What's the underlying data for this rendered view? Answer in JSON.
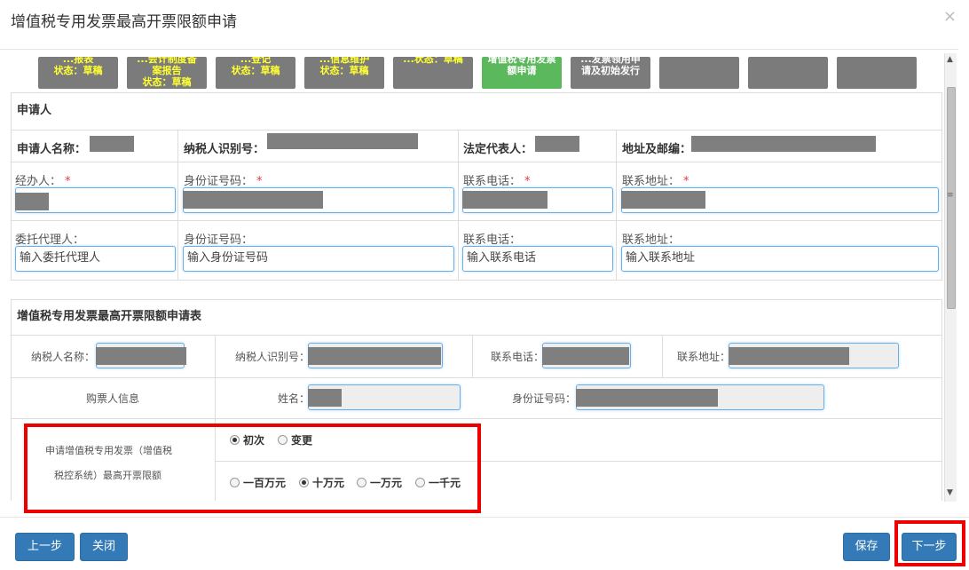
{
  "modal": {
    "title": "增值税专用发票最高开票限额申请",
    "close_icon": "×"
  },
  "steps": [
    {
      "label1": "...报表",
      "label2": "状态：草稿"
    },
    {
      "label1": "...会计制度备",
      "label2": "案报告",
      "label3": "状态：草稿"
    },
    {
      "label1": "...登记",
      "label2": "状态：草稿"
    },
    {
      "label1": "...信息维护",
      "label2": "状态：草稿"
    },
    {
      "label1": "...状态：草稿"
    },
    {
      "label1": "增值税专用发票",
      "label2": "额申请"
    },
    {
      "label1": "...发票领用申",
      "label2": "请及初始发行"
    },
    {
      "label1": ""
    },
    {
      "label1": ""
    },
    {
      "label1": ""
    }
  ],
  "applicant": {
    "section_title": "申请人",
    "name_label": "申请人名称：",
    "taxid_label": "纳税人识别号：",
    "legal_label": "法定代表人：",
    "addr_label": "地址及邮编：",
    "handler_label": "经办人：",
    "id_label": "身份证号码：",
    "phone_label": "联系电话：",
    "contact_addr_label": "联系地址：",
    "required_mark": "*",
    "agent_label": "委托代理人：",
    "agent_id_label": "身份证号码：",
    "agent_phone_label": "联系电话：",
    "agent_addr_label": "联系地址：",
    "agent_placeholder": "输入委托代理人",
    "agent_id_placeholder": "输入身份证号码",
    "agent_phone_placeholder": "输入联系电话",
    "agent_addr_placeholder": "输入联系地址"
  },
  "form": {
    "section_title": "增值税专用发票最高开票限额申请表",
    "taxpayer_name_label": "纳税人名称：",
    "taxid_label": "纳税人识别号：",
    "phone_label": "联系电话：",
    "address_label": "联系地址：",
    "buyer_info_label": "购票人信息",
    "buyer_name_label": "姓名：",
    "buyer_id_label": "身份证号码：",
    "apply_label_1": "申请增值税专用发票（增值税",
    "apply_label_2": "税控系统）最高开票限额",
    "type_options": [
      {
        "label": "初次",
        "checked": true
      },
      {
        "label": "变更",
        "checked": false
      }
    ],
    "limit_options": [
      {
        "label": "一百万元",
        "checked": false
      },
      {
        "label": "十万元",
        "checked": true
      },
      {
        "label": "一万元",
        "checked": false
      },
      {
        "label": "一千元",
        "checked": false
      }
    ]
  },
  "footer": {
    "prev": "上一步",
    "close": "关闭",
    "save": "保存",
    "next": "下一步"
  },
  "colors": {
    "primary": "#337ab7",
    "step_gray": "#7b7b7b",
    "step_green": "#5cb85c",
    "step_text": "#ffff33",
    "highlight": "#ee0000"
  }
}
